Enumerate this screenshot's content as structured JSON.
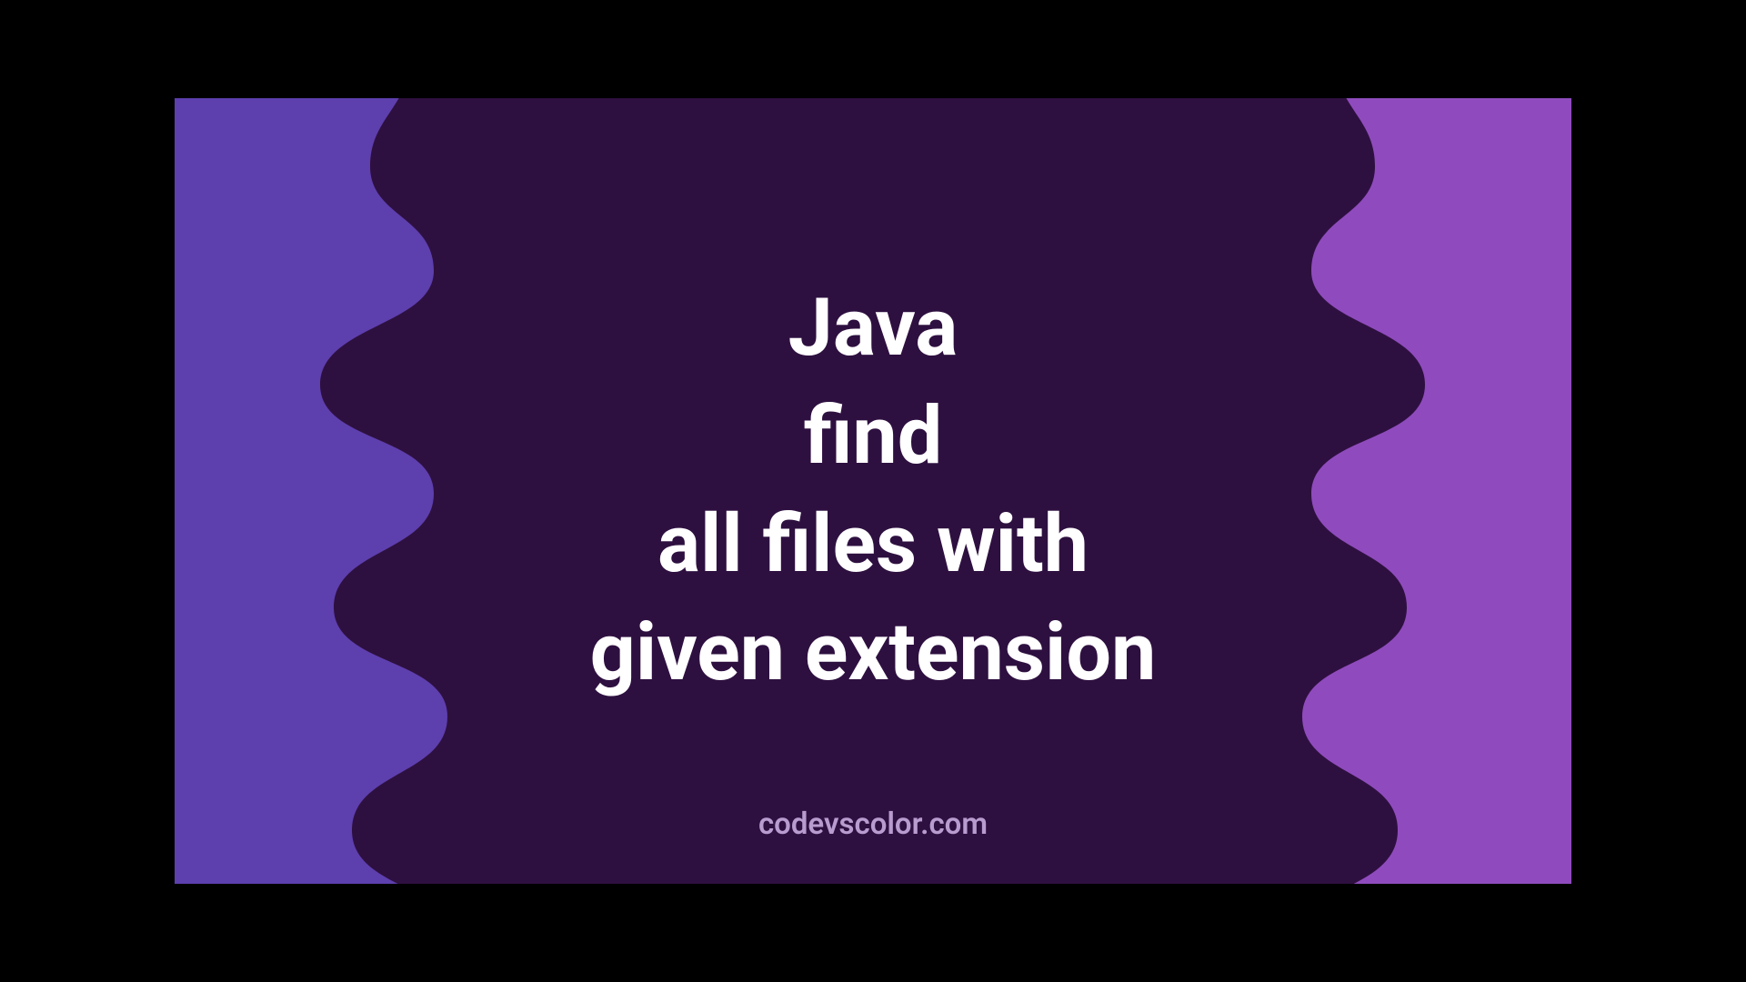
{
  "title": {
    "line1": "Java",
    "line2": "find",
    "line3": "all files with",
    "line4": "given extension"
  },
  "attribution": "codevscolor.com",
  "colors": {
    "left_bg": "#5d3fae",
    "right_bg": "#8f4bbd",
    "blob": "#2e1040",
    "text": "#ffffff",
    "attribution": "#b89cd0"
  }
}
